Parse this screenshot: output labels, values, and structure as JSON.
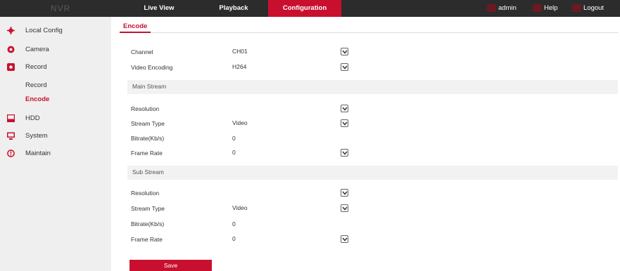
{
  "header": {
    "brand": "NVR",
    "tabs": [
      "Live View",
      "Playback",
      "Configuration"
    ],
    "user": "admin",
    "help": "Help",
    "logout": "Logout"
  },
  "sidebar": {
    "items": [
      "Local Config",
      "Camera",
      "Record",
      "HDD",
      "System",
      "Maintain"
    ],
    "record_sub": [
      "Record",
      "Encode"
    ]
  },
  "main": {
    "tab": "Encode",
    "channel_label": "Channel",
    "channel_value": "CH01",
    "video_encoding_label": "Video Encoding",
    "video_encoding_value": "H264",
    "main_stream": {
      "title": "Main Stream",
      "resolution_label": "Resolution",
      "resolution_value": "",
      "stream_type_label": "Stream Type",
      "stream_type_value": "Video",
      "bitrate_label": "Bitrate(Kb/s)",
      "bitrate_value": "0",
      "frame_rate_label": "Frame Rate",
      "frame_rate_value": "0"
    },
    "sub_stream": {
      "title": "Sub Stream",
      "resolution_label": "Resolution",
      "resolution_value": "",
      "stream_type_label": "Stream Type",
      "stream_type_value": "Video",
      "bitrate_label": "Bitrate(Kb/s)",
      "bitrate_value": "0",
      "frame_rate_label": "Frame Rate",
      "frame_rate_value": "0"
    },
    "save_label": "Save"
  },
  "colors": {
    "accent": "#c8102e",
    "topbar": "#2c2c2c",
    "sidebar": "#efefef"
  },
  "icons": [
    "local-config-icon",
    "camera-icon",
    "record-icon",
    "hdd-icon",
    "system-icon",
    "maintain-icon",
    "chevron-down-icon"
  ]
}
